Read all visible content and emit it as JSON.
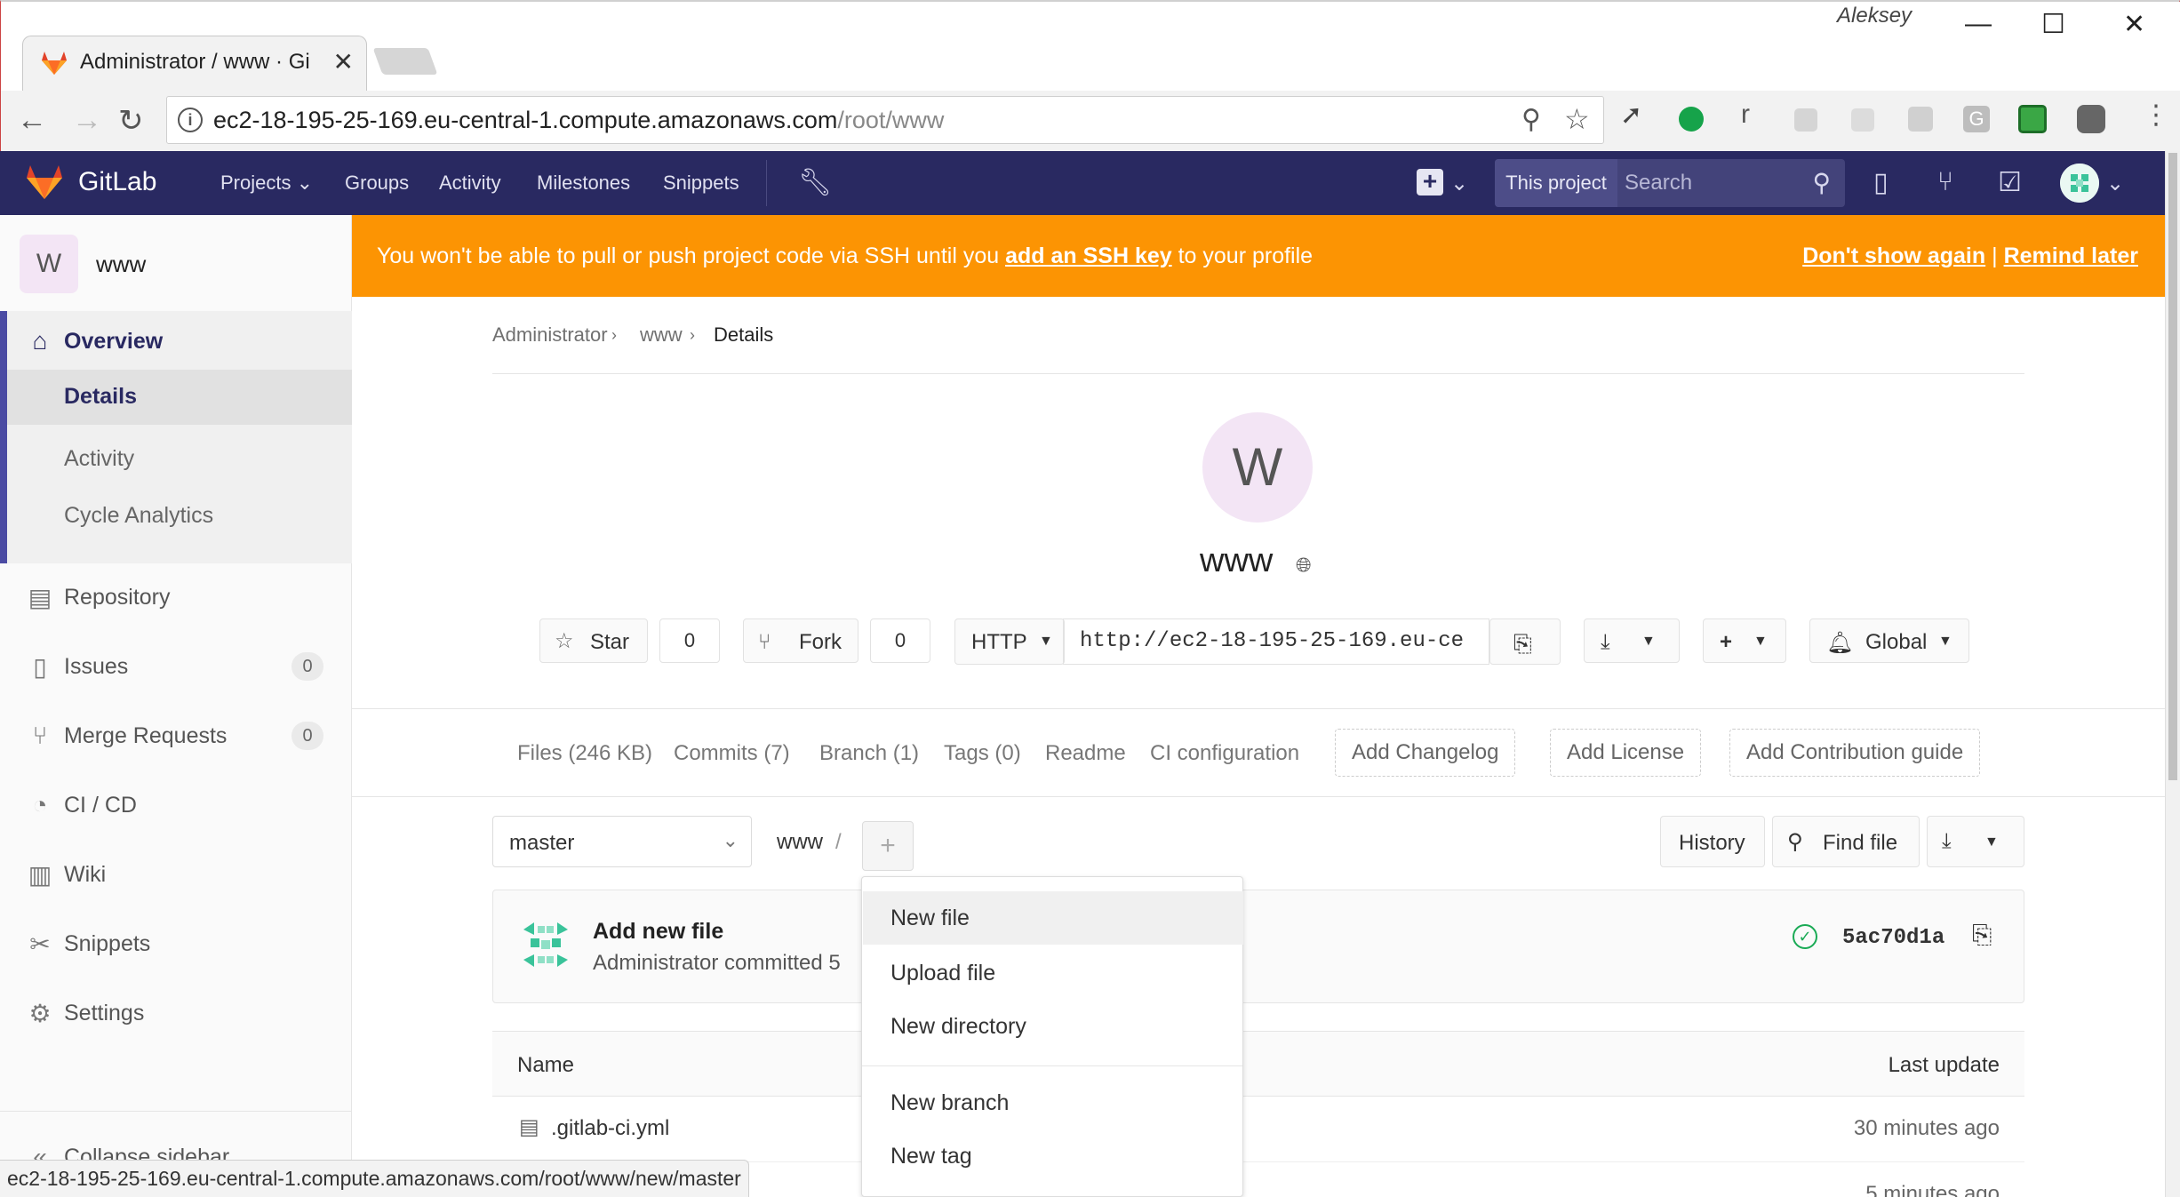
{
  "browser": {
    "tab_title": "Administrator / www · Gi",
    "user": "Aleksey",
    "url_host": "ec2-18-195-25-169.eu-central-1.compute.amazonaws.com",
    "url_path": "/root/www",
    "status_url": "ec2-18-195-25-169.eu-central-1.compute.amazonaws.com/root/www/new/master",
    "window_buttons": {
      "minimize": "—",
      "maximize": "☐",
      "close": "✕"
    }
  },
  "gitlab_header": {
    "brand": "GitLab",
    "nav": [
      "Projects",
      "Groups",
      "Activity",
      "Milestones",
      "Snippets"
    ],
    "search_scope": "This project",
    "search_placeholder": "Search"
  },
  "sidebar": {
    "project_initial": "W",
    "project_name": "www",
    "overview": "Overview",
    "overview_sub": [
      "Details",
      "Activity",
      "Cycle Analytics"
    ],
    "items": [
      {
        "label": "Repository",
        "icon": "repository-icon"
      },
      {
        "label": "Issues",
        "icon": "issues-icon",
        "count": "0"
      },
      {
        "label": "Merge Requests",
        "icon": "merge-request-icon",
        "count": "0"
      },
      {
        "label": "CI / CD",
        "icon": "ci-cd-icon"
      },
      {
        "label": "Wiki",
        "icon": "wiki-icon"
      },
      {
        "label": "Snippets",
        "icon": "snippets-icon"
      },
      {
        "label": "Settings",
        "icon": "gear-icon"
      }
    ],
    "collapse": "Collapse sidebar"
  },
  "banner": {
    "text_before": "You won't be able to pull or push project code via SSH until you ",
    "link": "add an SSH key",
    "text_after": " to your profile",
    "dont_show": "Don't show again",
    "separator": "|",
    "remind": "Remind later",
    "color": "#fc9403"
  },
  "breadcrumb": [
    "Administrator",
    "www",
    "Details"
  ],
  "project": {
    "initial": "W",
    "title": "www",
    "star_label": "Star",
    "star_count": "0",
    "fork_label": "Fork",
    "fork_count": "0",
    "protocol": "HTTP",
    "clone_url": "http://ec2-18-195-25-169.eu-ce",
    "notification": "Global"
  },
  "stats": {
    "links": [
      "Files (246 KB)",
      "Commits (7)",
      "Branch (1)",
      "Tags (0)",
      "Readme",
      "CI configuration"
    ],
    "dashed": [
      "Add Changelog",
      "Add License",
      "Add Contribution guide"
    ]
  },
  "repo_bar": {
    "branch": "master",
    "path": "www",
    "path_sep": "/",
    "history": "History",
    "find_file": "Find file"
  },
  "commit": {
    "title": "Add new file",
    "meta": "Administrator committed 5",
    "sha": "5ac70d1a"
  },
  "files": {
    "col_name": "Name",
    "col_update": "Last update",
    "rows": [
      {
        "name": ".gitlab-ci.yml",
        "updated": "30 minutes ago"
      },
      {
        "name": "",
        "updated": "5 minutes ago"
      }
    ]
  },
  "dropdown": {
    "items": [
      "New file",
      "Upload file",
      "New directory"
    ],
    "items2": [
      "New branch",
      "New tag"
    ]
  }
}
